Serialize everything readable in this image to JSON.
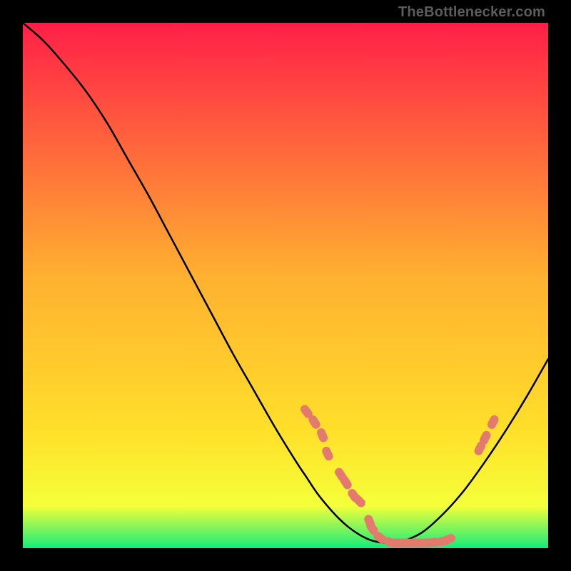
{
  "attribution": "TheBottlenecker.com",
  "colors": {
    "gradient_top": "#ff1f47",
    "gradient_mid": "#ffe02a",
    "gradient_bottom": "#15eb7a",
    "curve": "#000000",
    "marker_fill": "#e47a6e",
    "marker_stroke": "#c45e54",
    "background": "#000000"
  },
  "chart_data": {
    "type": "line",
    "title": "",
    "xlabel": "",
    "ylabel": "",
    "xlim": [
      0,
      100
    ],
    "ylim": [
      0,
      100
    ],
    "grid": false,
    "legend": false,
    "series": [
      {
        "name": "bottleneck-curve",
        "x": [
          0,
          4,
          8,
          12,
          16,
          20,
          24,
          28,
          32,
          36,
          40,
          44,
          48,
          52,
          54,
          56,
          58,
          60,
          62,
          64,
          66,
          68,
          70,
          72,
          76,
          80,
          84,
          88,
          92,
          96,
          100
        ],
        "y": [
          100,
          96.5,
          92,
          87,
          81,
          74,
          67,
          59.5,
          52,
          44.5,
          37,
          30,
          23,
          16.5,
          13.5,
          10.5,
          8,
          5.8,
          4,
          2.6,
          1.6,
          1.1,
          1,
          1.2,
          3,
          6.5,
          11,
          16.5,
          22.5,
          29,
          36
        ]
      }
    ],
    "markers": [
      {
        "group": "left-descent",
        "points": [
          {
            "x": 54,
            "y": 26
          },
          {
            "x": 55.5,
            "y": 24
          },
          {
            "x": 57,
            "y": 21.5
          },
          {
            "x": 58,
            "y": 18
          },
          {
            "x": 60.5,
            "y": 14
          },
          {
            "x": 61.5,
            "y": 12.5
          },
          {
            "x": 63,
            "y": 10
          },
          {
            "x": 64,
            "y": 9
          }
        ]
      },
      {
        "group": "valley-floor",
        "points": [
          {
            "x": 66,
            "y": 5
          },
          {
            "x": 66.5,
            "y": 3.8
          },
          {
            "x": 68,
            "y": 2
          },
          {
            "x": 70,
            "y": 1.1
          },
          {
            "x": 71,
            "y": 1
          },
          {
            "x": 72,
            "y": 1
          },
          {
            "x": 73.5,
            "y": 1
          },
          {
            "x": 75,
            "y": 1
          },
          {
            "x": 76.5,
            "y": 1
          },
          {
            "x": 78,
            "y": 1.1
          },
          {
            "x": 80,
            "y": 1.3
          },
          {
            "x": 81,
            "y": 1.7
          }
        ]
      },
      {
        "group": "right-ascent",
        "points": [
          {
            "x": 87,
            "y": 19
          },
          {
            "x": 88,
            "y": 21
          },
          {
            "x": 89.5,
            "y": 24
          }
        ]
      }
    ]
  }
}
